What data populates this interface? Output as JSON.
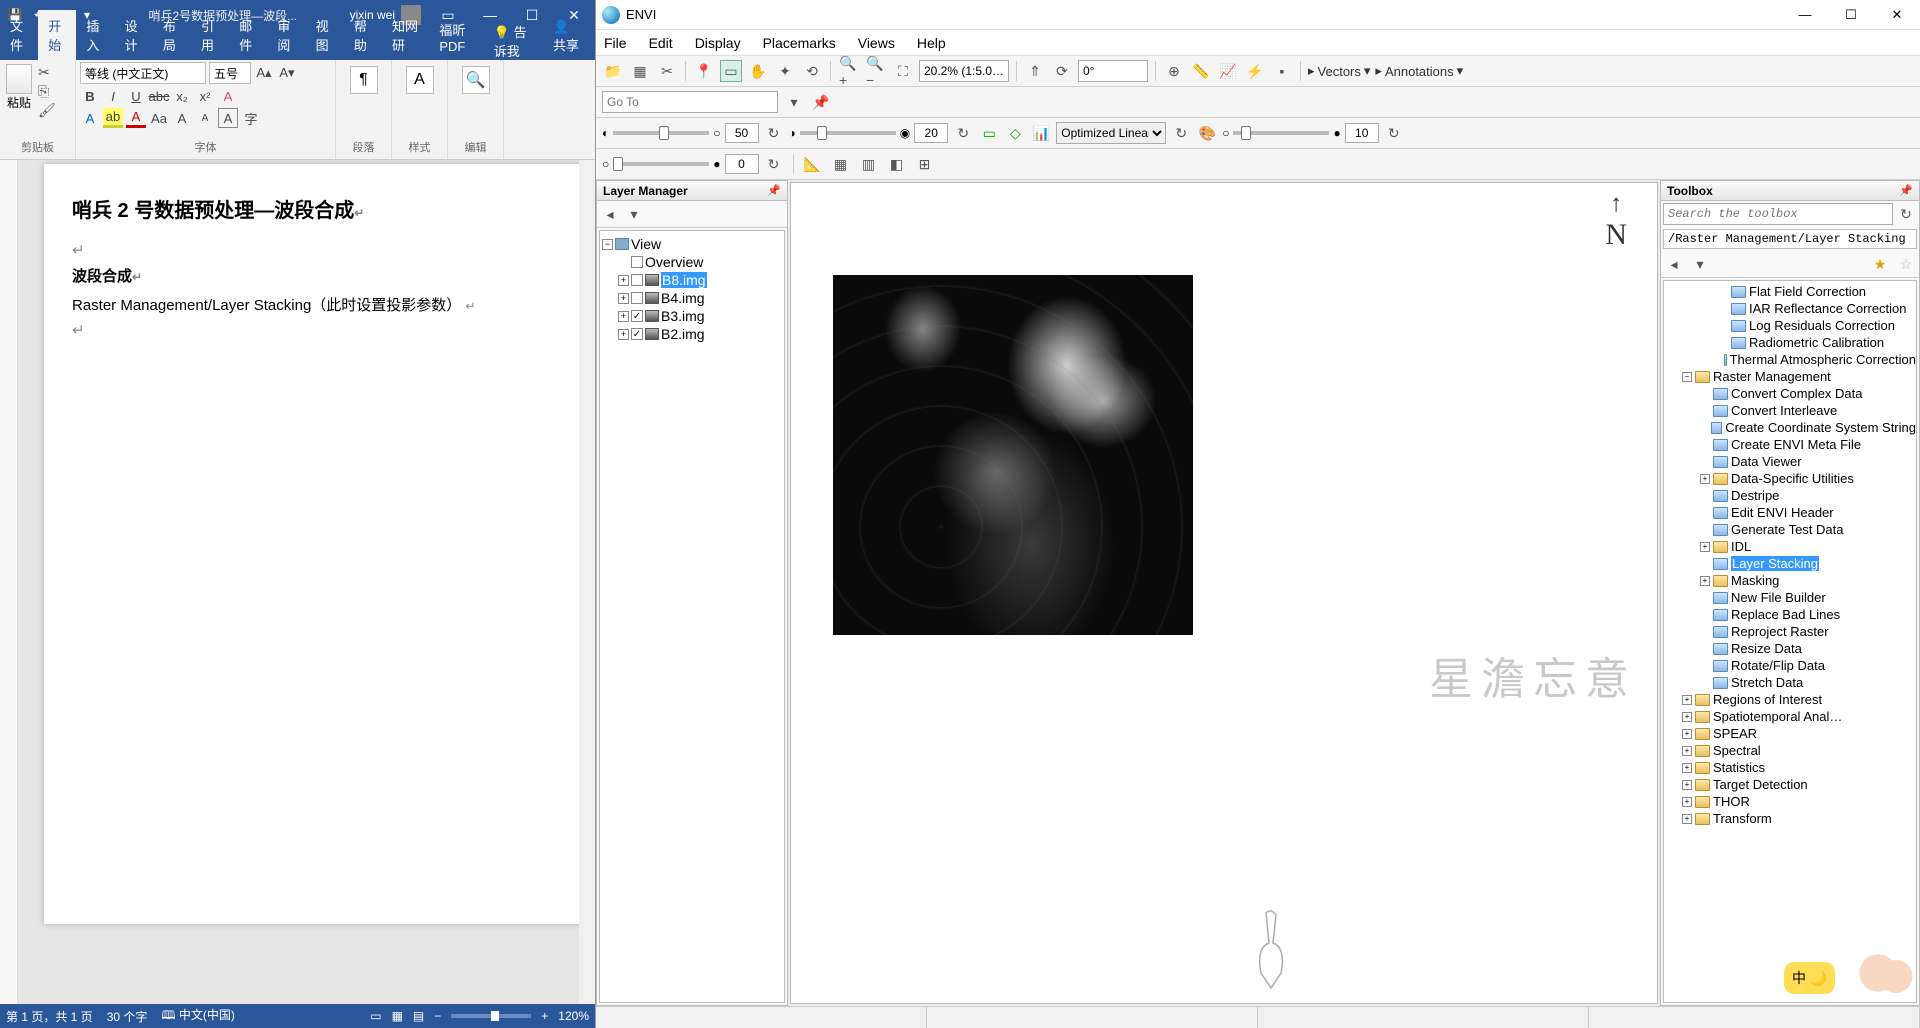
{
  "word": {
    "titlebar": {
      "doc_title": "哨兵2号数据预处理—波段...",
      "username": "yixin wei"
    },
    "tabs": [
      "文件",
      "开始",
      "插入",
      "设计",
      "布局",
      "引用",
      "邮件",
      "审阅",
      "视图",
      "帮助",
      "知网研",
      "福昕PDF"
    ],
    "active_tab_index": 1,
    "tellme": "告诉我",
    "share": "共享",
    "ribbon": {
      "clipboard_label": "剪贴板",
      "paste_label": "粘贴",
      "font_label": "字体",
      "font_name": "等线 (中文正文)",
      "font_size": "五号",
      "para_label": "段落",
      "style_label": "样式",
      "edit_label": "编辑"
    },
    "document": {
      "h1": "哨兵 2 号数据预处理—波段合成",
      "h2": "波段合成",
      "p1": "Raster Management/Layer Stacking（此时设置投影参数）"
    },
    "status": {
      "page": "第 1 页，共 1 页",
      "words": "30 个字",
      "lang": "中文(中国)",
      "zoom": "120%"
    }
  },
  "envi": {
    "title": "ENVI",
    "menus": [
      "File",
      "Edit",
      "Display",
      "Placemarks",
      "Views",
      "Help"
    ],
    "toolbar": {
      "zoom_combo": "20.2% (1:5.0…",
      "rotation": "0°",
      "vectors": "Vectors",
      "annotations": "Annotations",
      "goto_placeholder": "Go To"
    },
    "sliders": {
      "brightness_val": "50",
      "contrast_val": "20",
      "stretch_type": "Optimized Linear",
      "transp1": "10",
      "transp2": "0"
    },
    "layer_manager": {
      "title": "Layer Manager",
      "root": "View",
      "overview": "Overview",
      "layers": [
        {
          "name": "B8.img",
          "checked": false,
          "selected": true
        },
        {
          "name": "B4.img",
          "checked": false,
          "selected": false
        },
        {
          "name": "B3.img",
          "checked": true,
          "selected": false
        },
        {
          "name": "B2.img",
          "checked": true,
          "selected": false
        }
      ]
    },
    "compass": "N",
    "watermark": "星澹忘意",
    "toolbox": {
      "title": "Toolbox",
      "search_placeholder": "Search the toolbox",
      "path": "/Raster Management/Layer Stacking",
      "items_pre": [
        {
          "label": "Flat Field Correction",
          "level": 3,
          "kids": false
        },
        {
          "label": "IAR Reflectance Correction",
          "level": 3,
          "kids": false
        },
        {
          "label": "Log Residuals Correction",
          "level": 3,
          "kids": false
        },
        {
          "label": "Radiometric Calibration",
          "level": 3,
          "kids": false
        },
        {
          "label": "Thermal Atmospheric Correction",
          "level": 3,
          "kids": false
        }
      ],
      "folder_open": "Raster Management",
      "items_rm": [
        {
          "label": "Convert Complex Data",
          "kids": false
        },
        {
          "label": "Convert Interleave",
          "kids": false
        },
        {
          "label": "Create Coordinate System String",
          "kids": false
        },
        {
          "label": "Create ENVI Meta File",
          "kids": false
        },
        {
          "label": "Data Viewer",
          "kids": false
        },
        {
          "label": "Data-Specific Utilities",
          "kids": true
        },
        {
          "label": "Destripe",
          "kids": false
        },
        {
          "label": "Edit ENVI Header",
          "kids": false
        },
        {
          "label": "Generate Test Data",
          "kids": false
        },
        {
          "label": "IDL",
          "kids": true
        },
        {
          "label": "Layer Stacking",
          "kids": false,
          "selected": true
        },
        {
          "label": "Masking",
          "kids": true
        },
        {
          "label": "New File Builder",
          "kids": false
        },
        {
          "label": "Replace Bad Lines",
          "kids": false
        },
        {
          "label": "Reproject Raster",
          "kids": false
        },
        {
          "label": "Resize Data",
          "kids": false
        },
        {
          "label": "Rotate/Flip Data",
          "kids": false
        },
        {
          "label": "Stretch Data",
          "kids": false
        }
      ],
      "items_post": [
        {
          "label": "Regions of Interest",
          "kids": true
        },
        {
          "label": "Spatiotemporal Anal…",
          "kids": true
        },
        {
          "label": "SPEAR",
          "kids": true
        },
        {
          "label": "Spectral",
          "kids": true
        },
        {
          "label": "Statistics",
          "kids": true
        },
        {
          "label": "Target Detection",
          "kids": true
        },
        {
          "label": "THOR",
          "kids": true
        },
        {
          "label": "Transform",
          "kids": true
        }
      ]
    }
  },
  "ime_badge": "中"
}
